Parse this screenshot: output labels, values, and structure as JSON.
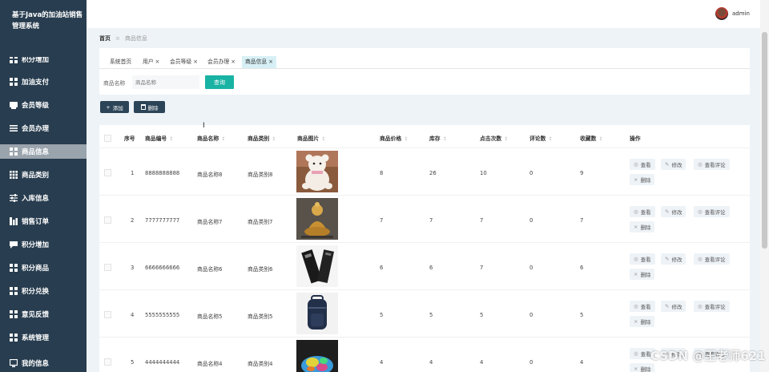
{
  "app": {
    "title": "基于Java的加油站销售管理系统"
  },
  "sidebar": {
    "items": [
      {
        "label": "积分增加",
        "icon": "grid-icon",
        "partial": true
      },
      {
        "label": "加油支付",
        "icon": "grid-icon"
      },
      {
        "label": "会员等级",
        "icon": "card-icon"
      },
      {
        "label": "会员办理",
        "icon": "list-icon"
      },
      {
        "label": "商品信息",
        "icon": "grid-icon",
        "active": true
      },
      {
        "label": "商品类别",
        "icon": "grid9-icon"
      },
      {
        "label": "入库信息",
        "icon": "sliders-icon"
      },
      {
        "label": "销售订单",
        "icon": "chart-icon"
      },
      {
        "label": "积分增加",
        "icon": "chat-icon"
      },
      {
        "label": "积分商品",
        "icon": "grid-icon"
      },
      {
        "label": "积分兑换",
        "icon": "grid-icon"
      },
      {
        "label": "意见反馈",
        "icon": "grid-icon"
      },
      {
        "label": "系统管理",
        "icon": "grid-icon"
      },
      {
        "label": "我的信息",
        "icon": "monitor-icon"
      }
    ]
  },
  "header": {
    "username": "admin"
  },
  "breadcrumb": {
    "home": "首页",
    "sep": "≡",
    "current": "商品信息"
  },
  "tabs": [
    {
      "label": "系统首页",
      "closable": false
    },
    {
      "label": "用户",
      "closable": true
    },
    {
      "label": "会员等级",
      "closable": true
    },
    {
      "label": "会员办理",
      "closable": true
    },
    {
      "label": "商品信息",
      "closable": true,
      "active": true
    }
  ],
  "tab_close_glyph": "×",
  "search": {
    "label": "商品名称",
    "placeholder": "商品名称",
    "button": "查询"
  },
  "toolbar": {
    "add_icon": "+",
    "add_label": "添加",
    "delete_icon": "🗑",
    "delete_label": "删除"
  },
  "table": {
    "headers": {
      "index": "序号",
      "code": "商品编号",
      "name": "商品名称",
      "category": "商品类别",
      "image": "商品图片",
      "price": "商品价格",
      "stock": "库存",
      "clicks": "点击次数",
      "comments": "评论数",
      "favorites": "收藏数",
      "actions": "操作"
    },
    "sort_glyph": "↕",
    "rows": [
      {
        "index": "1",
        "code": "8888888888",
        "name": "商品名称8",
        "category": "商品类别8",
        "image": "teddy-bear",
        "price": "8",
        "stock": "26",
        "clicks": "10",
        "comments": "0",
        "favorites": "9"
      },
      {
        "index": "2",
        "code": "7777777777",
        "name": "商品名称7",
        "category": "商品类别7",
        "image": "golden-buddha",
        "price": "7",
        "stock": "7",
        "clicks": "7",
        "comments": "0",
        "favorites": "7"
      },
      {
        "index": "3",
        "code": "6666666666",
        "name": "商品名称6",
        "category": "商品类别6",
        "image": "black-boxes",
        "price": "6",
        "stock": "6",
        "clicks": "7",
        "comments": "0",
        "favorites": "6"
      },
      {
        "index": "4",
        "code": "5555555555",
        "name": "商品名称5",
        "category": "商品类别5",
        "image": "backpack",
        "price": "5",
        "stock": "5",
        "clicks": "5",
        "comments": "0",
        "favorites": "5"
      },
      {
        "index": "5",
        "code": "4444444444",
        "name": "商品名称4",
        "category": "商品类别4",
        "image": "colorful-shoe",
        "price": "4",
        "stock": "4",
        "clicks": "4",
        "comments": "0",
        "favorites": "4"
      }
    ],
    "actions": {
      "view": "查看",
      "edit": "修改",
      "comments": "查看评论",
      "delete": "删除"
    },
    "action_icons": {
      "view": "◎",
      "edit": "✎",
      "comments": "◎",
      "delete": "×"
    }
  },
  "watermark": "CSDN @王老师621",
  "colors": {
    "sidebar_bg": "#283d4f",
    "accent": "#19b3a4",
    "active_menu": "#9aa4ad",
    "tab_active": "#d7f0f6"
  }
}
